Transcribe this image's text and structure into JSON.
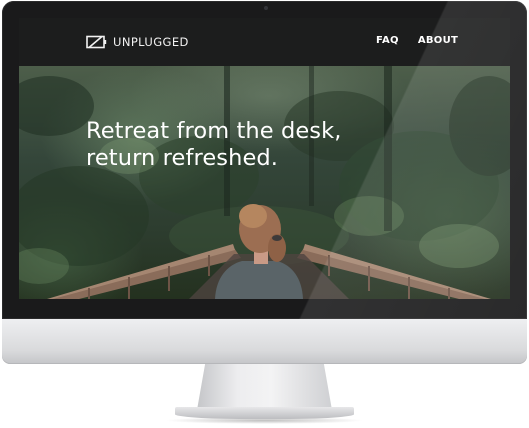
{
  "site": {
    "brand": "UNPLUGGED",
    "logo_icon": "unplugged-battery-icon",
    "nav": [
      {
        "label": "FAQ"
      },
      {
        "label": "ABOUT"
      }
    ]
  },
  "hero": {
    "title_line1": "Retreat from the desk,",
    "title_line2": "return refreshed."
  },
  "colors": {
    "header_background": "#1c1d1d",
    "bezel": "#1a1a1b",
    "text": "#ffffff"
  }
}
